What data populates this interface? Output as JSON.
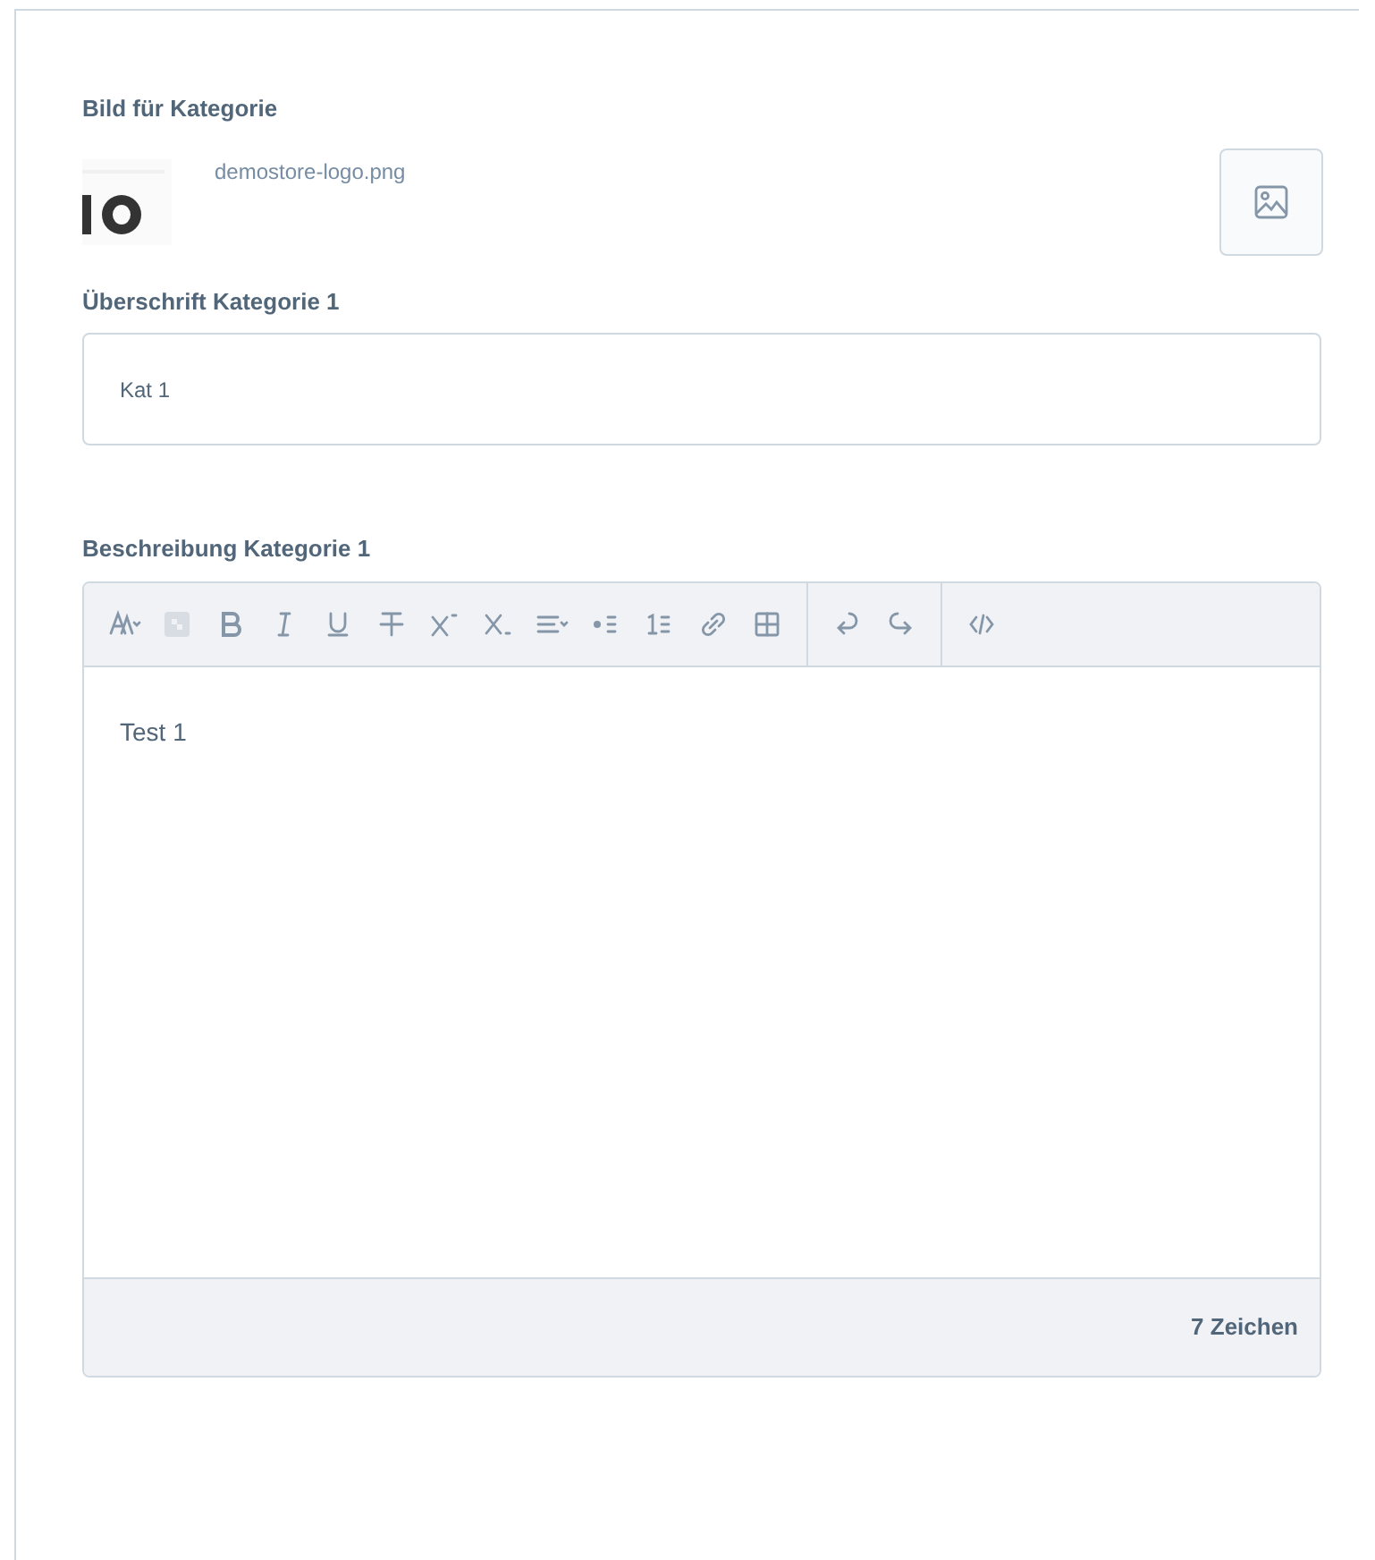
{
  "image_field": {
    "label": "Bild für Kategorie",
    "filename": "demostore-logo.png"
  },
  "title_field": {
    "label": "Überschrift Kategorie 1",
    "value": "Kat 1"
  },
  "description_field": {
    "label": "Beschreibung Kategorie 1",
    "content": "Test 1",
    "char_count": "7 Zeichen"
  }
}
